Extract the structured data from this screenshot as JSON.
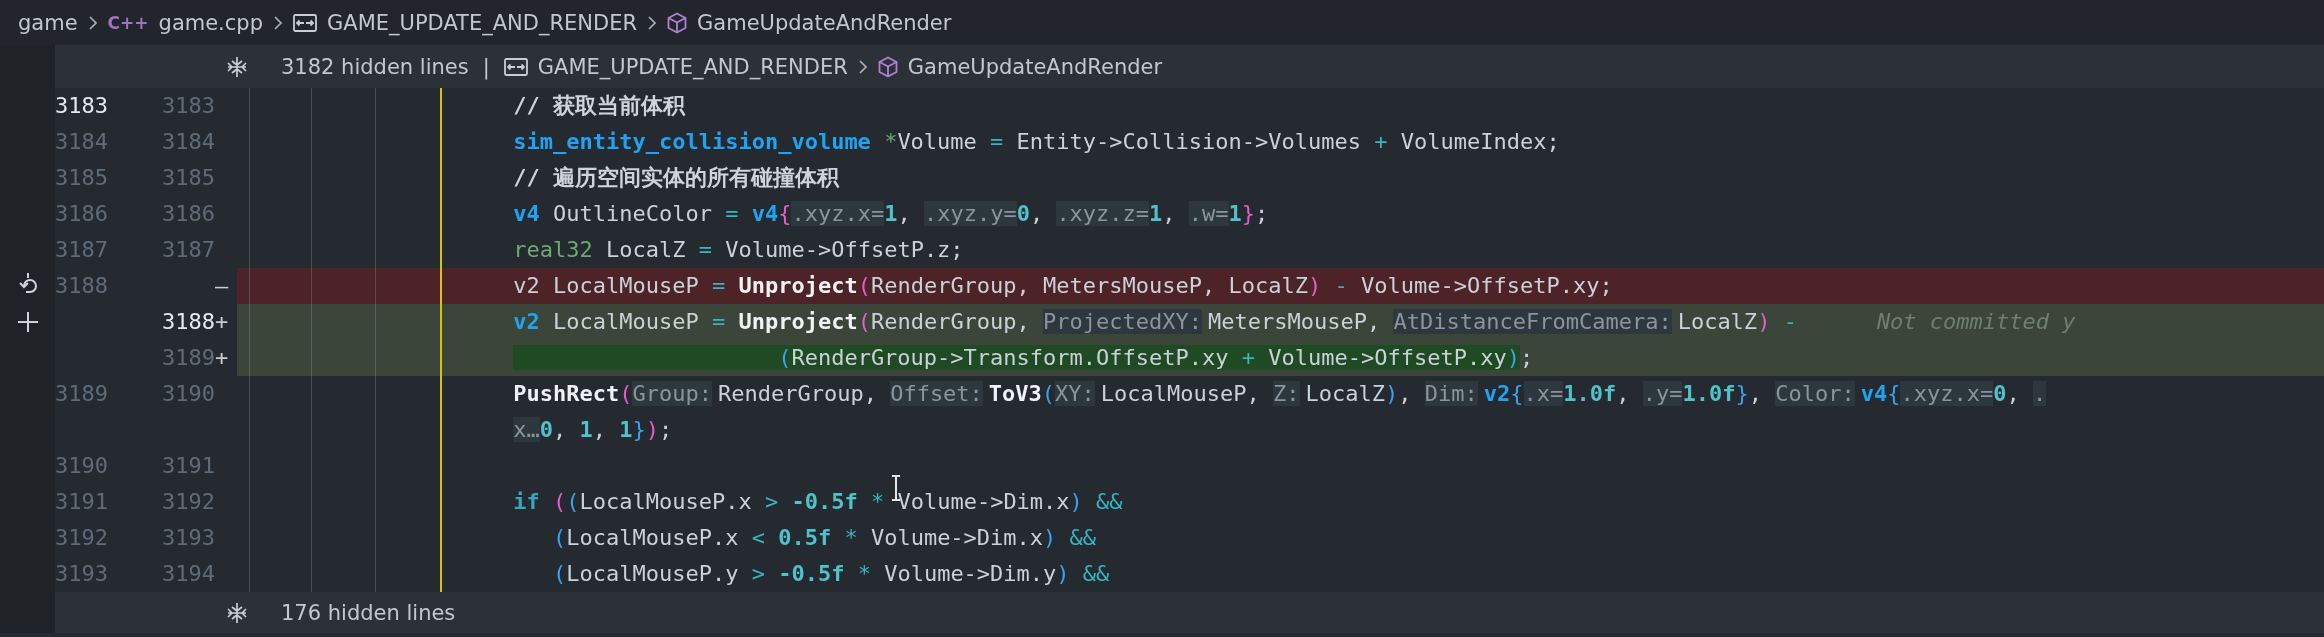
{
  "breadcrumb": [
    {
      "kind": "folder",
      "text": "game"
    },
    {
      "kind": "file",
      "icon": "C++",
      "text": "game.cpp"
    },
    {
      "kind": "macro",
      "text": "GAME_UPDATE_AND_RENDER"
    },
    {
      "kind": "function",
      "text": "GameUpdateAndRender"
    }
  ],
  "top_fold": {
    "hidden_lines": "3182 hidden lines",
    "separator": "|",
    "crumbs": [
      {
        "kind": "macro",
        "text": "GAME_UPDATE_AND_RENDER"
      },
      {
        "kind": "function",
        "text": "GameUpdateAndRender"
      }
    ]
  },
  "rows": [
    {
      "old": "3183",
      "new": "3183",
      "old_active": true,
      "new_active": false,
      "removed": false,
      "added": false,
      "tokens": [
        {
          "kind": "comment",
          "text": "// 获取当前体积"
        }
      ]
    },
    {
      "old": "3184",
      "new": "3184",
      "old_active": false,
      "new_active": false,
      "removed": false,
      "added": false,
      "tokens": [
        {
          "kind": "kw",
          "text": "sim_entity_collision_volume "
        },
        {
          "kind": "type",
          "text": "*"
        },
        {
          "kind": "text",
          "text": "Volume "
        },
        {
          "kind": "op",
          "text": "="
        },
        {
          "kind": "text",
          "text": " Entity->Collision->Volumes "
        },
        {
          "kind": "op",
          "text": "+"
        },
        {
          "kind": "text",
          "text": " VolumeIndex;"
        }
      ]
    },
    {
      "old": "3185",
      "new": "3185",
      "old_active": false,
      "new_active": false,
      "removed": false,
      "added": false,
      "tokens": [
        {
          "kind": "comment",
          "text": "// 遍历空间实体的所有碰撞体积"
        }
      ]
    },
    {
      "old": "3186",
      "new": "3186",
      "old_active": false,
      "new_active": false,
      "removed": false,
      "added": false,
      "tokens": [
        {
          "kind": "kw",
          "text": "v4"
        },
        {
          "kind": "text",
          "text": " OutlineColor "
        },
        {
          "kind": "op",
          "text": "= "
        },
        {
          "kind": "kw",
          "text": "v4"
        },
        {
          "kind": "paren1",
          "text": "{"
        },
        {
          "kind": "hint",
          "text": ".xyz.x="
        },
        {
          "kind": "num",
          "text": "1"
        },
        {
          "kind": "text",
          "text": ", "
        },
        {
          "kind": "hint",
          "text": ".xyz.y="
        },
        {
          "kind": "num",
          "text": "0"
        },
        {
          "kind": "text",
          "text": ", "
        },
        {
          "kind": "hint",
          "text": ".xyz.z="
        },
        {
          "kind": "num",
          "text": "1"
        },
        {
          "kind": "text",
          "text": ", "
        },
        {
          "kind": "hint",
          "text": ".w="
        },
        {
          "kind": "num",
          "text": "1"
        },
        {
          "kind": "paren1",
          "text": "}"
        },
        {
          "kind": "text",
          "text": ";"
        }
      ]
    },
    {
      "old": "3187",
      "new": "3187",
      "old_active": false,
      "new_active": false,
      "removed": false,
      "added": false,
      "tokens": [
        {
          "kind": "type",
          "text": "real32"
        },
        {
          "kind": "text",
          "text": " LocalZ "
        },
        {
          "kind": "op",
          "text": "="
        },
        {
          "kind": "text",
          "text": " Volume->OffsetP.z;"
        }
      ]
    },
    {
      "old": "3188",
      "marker": "—",
      "old_active": false,
      "removed": true,
      "added": false,
      "tokens": [
        {
          "kind": "text",
          "text": "v2 LocalMouseP "
        },
        {
          "kind": "op",
          "text": "= "
        },
        {
          "kind": "fn",
          "text": "Unproject"
        },
        {
          "kind": "paren1",
          "text": "("
        },
        {
          "kind": "text",
          "text": "RenderGroup, MetersMouseP, LocalZ"
        },
        {
          "kind": "paren1",
          "text": ") "
        },
        {
          "kind": "op",
          "text": "-"
        },
        {
          "kind": "text",
          "text": " Volume->OffsetP.xy;"
        }
      ]
    },
    {
      "new": "3188",
      "marker": "+",
      "new_active": true,
      "removed": false,
      "added": true,
      "tokens": [
        {
          "kind": "kw",
          "text": "v2",
          "inserted": false
        },
        {
          "kind": "text",
          "text": " LocalMouseP ",
          "inserted": false
        },
        {
          "kind": "op",
          "text": "= ",
          "inserted": false
        },
        {
          "kind": "fn",
          "text": "Unproject",
          "inserted": false
        },
        {
          "kind": "paren1",
          "text": "(",
          "inserted": false
        },
        {
          "kind": "text",
          "text": "RenderGroup, ",
          "inserted": false
        },
        {
          "kind": "param",
          "text": "ProjectedXY:",
          "inserted": false
        },
        {
          "kind": "text",
          "text": "MetersMouseP, ",
          "inserted": false
        },
        {
          "kind": "param",
          "text": "AtDistanceFromCamera:",
          "inserted": false
        },
        {
          "kind": "text",
          "text": "LocalZ",
          "inserted": false
        },
        {
          "kind": "paren1",
          "text": ") ",
          "inserted": false
        },
        {
          "kind": "op",
          "text": "-",
          "inserted": false
        },
        {
          "kind": "blame",
          "text": "Not committed y",
          "inserted": false
        }
      ]
    },
    {
      "new": "3189",
      "marker": "+",
      "new_active": false,
      "removed": false,
      "added": true,
      "tokens": [
        {
          "kind": "paren2",
          "text": "                    (",
          "inserted": true
        },
        {
          "kind": "text",
          "text": "RenderGroup->Transform.OffsetP.xy ",
          "inserted": true
        },
        {
          "kind": "op",
          "text": "+",
          "inserted": true
        },
        {
          "kind": "text",
          "text": " Volume->OffsetP.xy",
          "inserted": true
        },
        {
          "kind": "paren2",
          "text": ")",
          "inserted": true
        },
        {
          "kind": "text",
          "text": ";",
          "inserted": false
        }
      ]
    },
    {
      "old": "3189",
      "new": "3190",
      "old_active": false,
      "new_active": false,
      "removed": false,
      "added": false,
      "tokens": [
        {
          "kind": "fn",
          "text": "PushRect"
        },
        {
          "kind": "paren1",
          "text": "("
        },
        {
          "kind": "param",
          "text": "Group:"
        },
        {
          "kind": "text",
          "text": "RenderGroup, "
        },
        {
          "kind": "param",
          "text": "Offset:"
        },
        {
          "kind": "fn",
          "text": "ToV3"
        },
        {
          "kind": "paren2",
          "text": "("
        },
        {
          "kind": "param",
          "text": "XY:"
        },
        {
          "kind": "text",
          "text": "LocalMouseP, "
        },
        {
          "kind": "param",
          "text": "Z:"
        },
        {
          "kind": "text",
          "text": "LocalZ"
        },
        {
          "kind": "paren2",
          "text": ")"
        },
        {
          "kind": "text",
          "text": ", "
        },
        {
          "kind": "param",
          "text": "Dim:"
        },
        {
          "kind": "kw",
          "text": "v2"
        },
        {
          "kind": "paren2",
          "text": "{"
        },
        {
          "kind": "hint",
          "text": ".x="
        },
        {
          "kind": "num",
          "text": "1.0f"
        },
        {
          "kind": "text",
          "text": ", "
        },
        {
          "kind": "hint",
          "text": ".y="
        },
        {
          "kind": "num",
          "text": "1.0f"
        },
        {
          "kind": "paren2",
          "text": "}"
        },
        {
          "kind": "text",
          "text": ", "
        },
        {
          "kind": "param",
          "text": "Color:"
        },
        {
          "kind": "kw",
          "text": "v4"
        },
        {
          "kind": "paren2",
          "text": "{"
        },
        {
          "kind": "hint",
          "text": ".xyz.x="
        },
        {
          "kind": "num",
          "text": "0"
        },
        {
          "kind": "text",
          "text": ", "
        },
        {
          "kind": "hint",
          "text": "."
        }
      ]
    },
    {
      "removed": false,
      "added": false,
      "tokens": [
        {
          "kind": "hint",
          "text": "x…"
        },
        {
          "kind": "num",
          "text": "0"
        },
        {
          "kind": "text",
          "text": ", "
        },
        {
          "kind": "num",
          "text": "1"
        },
        {
          "kind": "text",
          "text": ", "
        },
        {
          "kind": "num",
          "text": "1"
        },
        {
          "kind": "paren2",
          "text": "}"
        },
        {
          "kind": "paren1",
          "text": ")"
        },
        {
          "kind": "text",
          "text": ";"
        }
      ]
    },
    {
      "old": "3190",
      "new": "3191",
      "old_active": false,
      "new_active": false,
      "removed": false,
      "added": false
    },
    {
      "old": "3191",
      "new": "3192",
      "old_active": false,
      "new_active": false,
      "removed": false,
      "added": false,
      "tokens": [
        {
          "kind": "ctrl",
          "text": "if "
        },
        {
          "kind": "paren1",
          "text": "("
        },
        {
          "kind": "paren2",
          "text": "("
        },
        {
          "kind": "text",
          "text": "LocalMouseP.x "
        },
        {
          "kind": "op",
          "text": "> "
        },
        {
          "kind": "num",
          "text": "-0.5f "
        },
        {
          "kind": "op",
          "text": "*"
        },
        {
          "kind": "text",
          "text": " Volume->Dim.x"
        },
        {
          "kind": "paren2",
          "text": ") "
        },
        {
          "kind": "op",
          "text": "&&"
        }
      ]
    },
    {
      "old": "3192",
      "new": "3193",
      "old_active": false,
      "new_active": false,
      "removed": false,
      "added": false,
      "tokens": [
        {
          "kind": "paren2",
          "text": "   ("
        },
        {
          "kind": "text",
          "text": "LocalMouseP.x "
        },
        {
          "kind": "op",
          "text": "< "
        },
        {
          "kind": "num",
          "text": "0.5f "
        },
        {
          "kind": "op",
          "text": "*"
        },
        {
          "kind": "text",
          "text": " Volume->Dim.x"
        },
        {
          "kind": "paren2",
          "text": ") "
        },
        {
          "kind": "op",
          "text": "&&"
        }
      ]
    },
    {
      "old": "3193",
      "new": "3194",
      "old_active": false,
      "new_active": false,
      "removed": false,
      "added": false,
      "tokens": [
        {
          "kind": "paren2",
          "text": "   ("
        },
        {
          "kind": "text",
          "text": "LocalMouseP.y "
        },
        {
          "kind": "op",
          "text": "> "
        },
        {
          "kind": "num",
          "text": "-0.5f "
        },
        {
          "kind": "op",
          "text": "*"
        },
        {
          "kind": "text",
          "text": " Volume->Dim.y"
        },
        {
          "kind": "paren2",
          "text": ") "
        },
        {
          "kind": "op",
          "text": "&&"
        }
      ]
    }
  ],
  "bottom_fold": {
    "hidden_lines": "176 hidden lines"
  }
}
